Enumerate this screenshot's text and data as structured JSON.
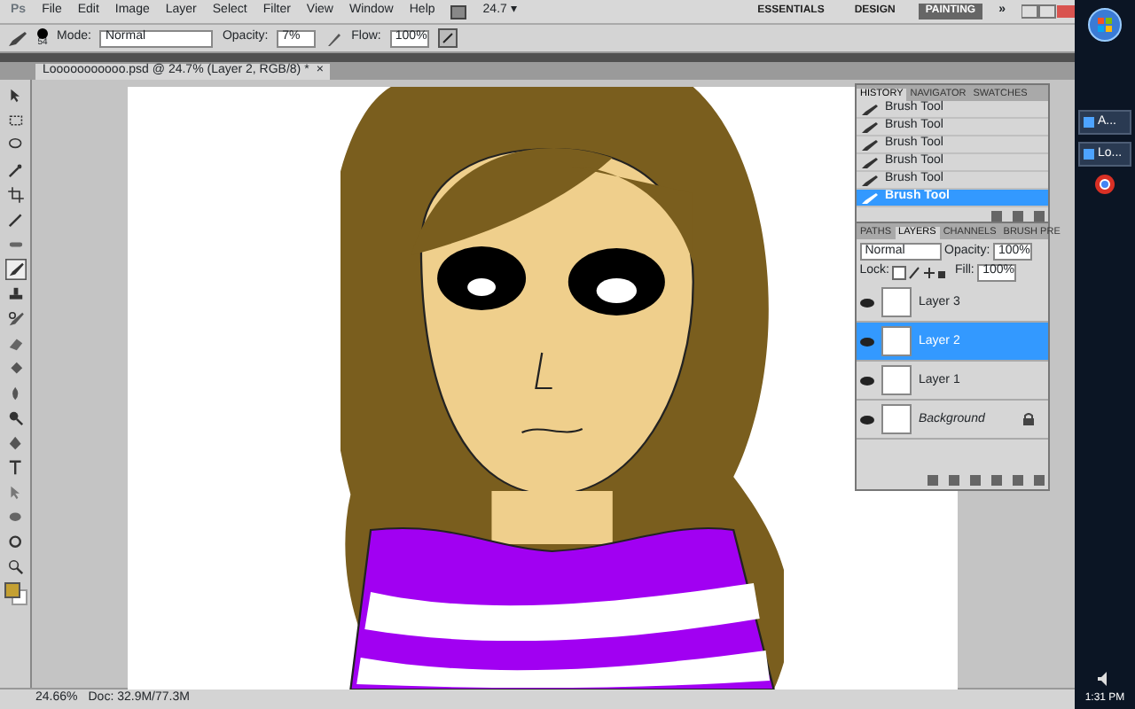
{
  "app_logo": "Ps",
  "menu": [
    "File",
    "Edit",
    "Image",
    "Layer",
    "Select",
    "Filter",
    "View",
    "Window",
    "Help"
  ],
  "zoom_level": "24.7 ▾",
  "workspaces": [
    {
      "label": "ESSENTIALS",
      "selected": false
    },
    {
      "label": "DESIGN",
      "selected": false
    },
    {
      "label": "PAINTING",
      "selected": true
    }
  ],
  "more_workspaces": "»",
  "options": {
    "brush_size": "54",
    "mode_label": "Mode:",
    "mode": "Normal",
    "opacity_label": "Opacity:",
    "opacity": "7%",
    "flow_label": "Flow:",
    "flow": "100%"
  },
  "document_tab": {
    "title": "Looooooooooo.psd @ 24.7% (Layer 2, RGB/8) *",
    "close": "×"
  },
  "tools": [
    {
      "kind": "move",
      "selected": false
    },
    {
      "kind": "marquee",
      "selected": false
    },
    {
      "kind": "lasso",
      "selected": false
    },
    {
      "kind": "wand",
      "selected": false
    },
    {
      "kind": "crop",
      "selected": false
    },
    {
      "kind": "eyedropper",
      "selected": false
    },
    {
      "kind": "healing",
      "selected": false
    },
    {
      "kind": "brush",
      "selected": true
    },
    {
      "kind": "stamp",
      "selected": false
    },
    {
      "kind": "history",
      "selected": false
    },
    {
      "kind": "eraser",
      "selected": false
    },
    {
      "kind": "bucket",
      "selected": false
    },
    {
      "kind": "blur",
      "selected": false
    },
    {
      "kind": "dodge",
      "selected": false
    },
    {
      "kind": "pen",
      "selected": false
    },
    {
      "kind": "type",
      "selected": false
    },
    {
      "kind": "select",
      "selected": false
    },
    {
      "kind": "shape",
      "selected": false
    },
    {
      "kind": "rotate",
      "selected": false
    },
    {
      "kind": "zoom",
      "selected": false
    }
  ],
  "history": {
    "tabs": [
      {
        "label": "HISTORY",
        "selected": true
      },
      {
        "label": "NAVIGATOR",
        "selected": false
      },
      {
        "label": "SWATCHES",
        "selected": false
      }
    ],
    "items": [
      {
        "label": "Brush Tool",
        "selected": false
      },
      {
        "label": "Brush Tool",
        "selected": false
      },
      {
        "label": "Brush Tool",
        "selected": false
      },
      {
        "label": "Brush Tool",
        "selected": false
      },
      {
        "label": "Brush Tool",
        "selected": false
      },
      {
        "label": "Brush Tool",
        "selected": true
      }
    ]
  },
  "layers": {
    "tabs": [
      {
        "label": "PATHS",
        "selected": false
      },
      {
        "label": "LAYERS",
        "selected": true
      },
      {
        "label": "CHANNELS",
        "selected": false
      },
      {
        "label": "BRUSH PRE",
        "selected": false
      }
    ],
    "blend_mode": "Normal",
    "opacity_label": "Opacity:",
    "opacity": "100%",
    "lock_label": "Lock:",
    "fill_label": "Fill:",
    "fill": "100%",
    "items": [
      {
        "name": "Layer 3",
        "selected": false,
        "visible": true,
        "locked": false
      },
      {
        "name": "Layer 2",
        "selected": true,
        "visible": true,
        "locked": false
      },
      {
        "name": "Layer 1",
        "selected": false,
        "visible": true,
        "locked": false
      },
      {
        "name": "Background",
        "selected": false,
        "visible": true,
        "locked": true
      }
    ]
  },
  "status_bar": {
    "zoom": "24.66%",
    "doc": "Doc: 32.9M/77.3M"
  },
  "taskbar": {
    "items": [
      "A...",
      "Lo..."
    ],
    "clock": "1:31 PM"
  }
}
